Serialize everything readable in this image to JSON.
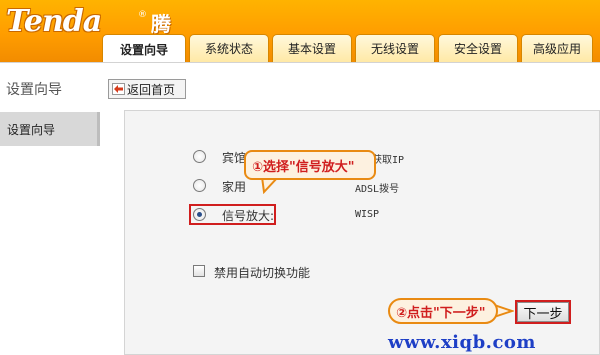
{
  "header": {
    "logo_text": "Tenda",
    "logo_registered": "®",
    "logo_cn": "腾达",
    "tabs": [
      {
        "label": "设置向导",
        "active": true
      },
      {
        "label": "系统状态",
        "active": false
      },
      {
        "label": "基本设置",
        "active": false
      },
      {
        "label": "无线设置",
        "active": false
      },
      {
        "label": "安全设置",
        "active": false
      },
      {
        "label": "高级应用",
        "active": false
      }
    ]
  },
  "subbar": {
    "section_title": "设置向导",
    "back_label": "返回首页",
    "back_icon": "back-arrow-icon"
  },
  "sidebar": {
    "items": [
      {
        "label": "设置向导",
        "selected": true
      }
    ]
  },
  "main": {
    "options": [
      {
        "label": "宾馆",
        "desc": "获取IP",
        "checked": false
      },
      {
        "label": "家用",
        "desc": "ADSL拨号",
        "checked": false
      },
      {
        "label": "信号放大:",
        "desc": "WISP",
        "checked": true
      }
    ],
    "auto_switch_label": "禁用自动切换功能",
    "next_label": "下一步"
  },
  "annotations": {
    "callout_1": "①选择\"信号放大\"",
    "callout_2": "②点击\"下一步\"",
    "highlight_color": "#d01e1e",
    "callout_border_color": "#e98a12"
  },
  "watermark": "www.xiqb.com",
  "colors": {
    "header_orange": "#ff9d00",
    "tab_border": "#d68600",
    "panel_bg": "#f4f4f4",
    "sidebar_selected_bg": "#d8d8d8"
  }
}
